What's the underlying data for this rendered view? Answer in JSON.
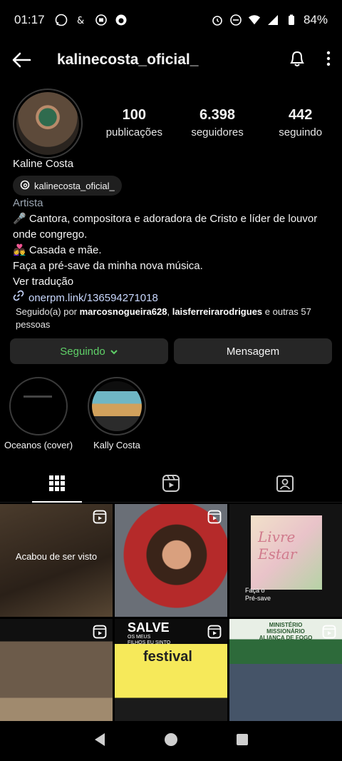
{
  "status": {
    "time": "01:17",
    "battery": "84%"
  },
  "header": {
    "username": "kalinecosta_oficial_"
  },
  "stats": [
    {
      "num": "100",
      "label": "publicações"
    },
    {
      "num": "6.398",
      "label": "seguidores"
    },
    {
      "num": "442",
      "label": "seguindo"
    }
  ],
  "profile": {
    "name": "Kaline Costa",
    "threads": "kalinecosta_oficial_",
    "category": "Artista",
    "bio_line1": "🎤 Cantora, compositora e adoradora de Cristo e líder de louvor onde congrego.",
    "bio_line2": "👩‍❤️‍👨 Casada e mãe.",
    "bio_line3": "Faça a pré-save da minha nova música.",
    "translate": "Ver tradução",
    "link": "onerpm.link/136594271018",
    "followed_prefix": "Seguido(a) por ",
    "followed_user1": "marcosnogueira628",
    "followed_sep": ", ",
    "followed_user2": "laisferreirarodrigues",
    "followed_suffix": " e outras 57 pessoas"
  },
  "buttons": {
    "following": "Seguindo",
    "message": "Mensagem"
  },
  "highlights": [
    {
      "label": "Oceanos (cover)"
    },
    {
      "label": "Kally Costa"
    }
  ],
  "grid": {
    "seen": "Acabou de ser visto",
    "poster_title": "Livre Estar",
    "poster_small": "Faça o\nPré-save",
    "salve_title": "SALVE",
    "salve_sub": "OS MEUS\nFILHOS EU SINTO",
    "festival": "festival",
    "banner": "MINISTÉRIO MISSIONÁRIO ALIANÇA DE FOGO"
  }
}
